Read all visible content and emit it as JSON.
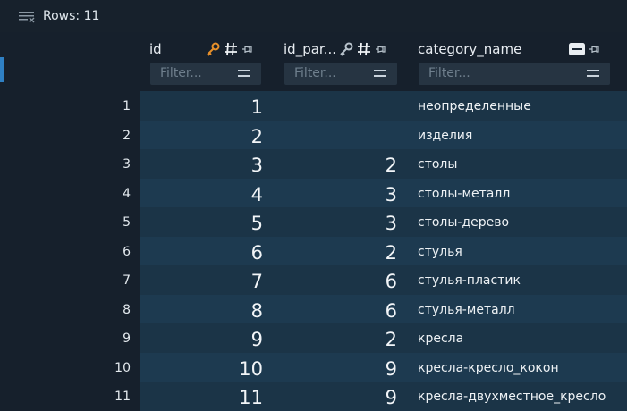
{
  "toolbar": {
    "rows_label": "Rows: 11"
  },
  "columns": [
    {
      "name": "id",
      "filter_placeholder": "Filter..."
    },
    {
      "name": "id_par...",
      "filter_placeholder": "Filter..."
    },
    {
      "name": "category_name",
      "filter_placeholder": "Filter..."
    }
  ],
  "rows": [
    {
      "num": "1",
      "id": "1",
      "id_parent": "",
      "category_name": "неопределенные"
    },
    {
      "num": "2",
      "id": "2",
      "id_parent": "",
      "category_name": "изделия"
    },
    {
      "num": "3",
      "id": "3",
      "id_parent": "2",
      "category_name": "столы"
    },
    {
      "num": "4",
      "id": "4",
      "id_parent": "3",
      "category_name": "столы-металл"
    },
    {
      "num": "5",
      "id": "5",
      "id_parent": "3",
      "category_name": "столы-дерево"
    },
    {
      "num": "6",
      "id": "6",
      "id_parent": "2",
      "category_name": "стулья"
    },
    {
      "num": "7",
      "id": "7",
      "id_parent": "6",
      "category_name": "стулья-пластик"
    },
    {
      "num": "8",
      "id": "8",
      "id_parent": "6",
      "category_name": "стулья-металл"
    },
    {
      "num": "9",
      "id": "9",
      "id_parent": "2",
      "category_name": "кресла"
    },
    {
      "num": "10",
      "id": "10",
      "id_parent": "9",
      "category_name": "кресла-кресло_кокон"
    },
    {
      "num": "11",
      "id": "11",
      "id_parent": "9",
      "category_name": "кресла-двухместное_кресло"
    }
  ],
  "colors": {
    "key_icon": "#e8902a",
    "row_odd": "#1b3447",
    "row_even": "#1d3a50"
  }
}
